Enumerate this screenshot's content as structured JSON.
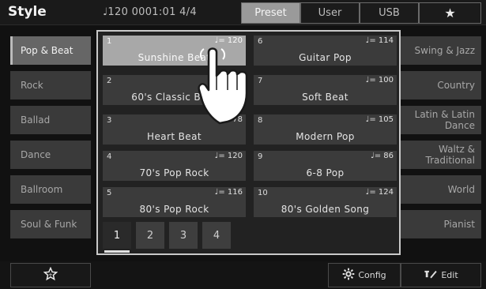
{
  "header": {
    "title": "Style",
    "tempo_readout": "♩120  0001:01  4/4",
    "tabs": [
      "Preset",
      "User",
      "USB",
      "★"
    ]
  },
  "left_categories": [
    "Pop & Beat",
    "Rock",
    "Ballad",
    "Dance",
    "Ballroom",
    "Soul & Funk"
  ],
  "right_categories": [
    "Swing & Jazz",
    "Country",
    "Latin & Latin\nDance",
    "Waltz &\nTraditional",
    "World",
    "Pianist"
  ],
  "styles": [
    {
      "num": "1",
      "tempo": "♩= 120",
      "name": "Sunshine Beat"
    },
    {
      "num": "2",
      "tempo": "♩= 1",
      "name": "60's Classic Beat"
    },
    {
      "num": "3",
      "tempo": "♩= 78",
      "name": "Heart Beat"
    },
    {
      "num": "4",
      "tempo": "♩= 120",
      "name": "70's Pop Rock"
    },
    {
      "num": "5",
      "tempo": "♩= 116",
      "name": "80's Pop Rock"
    },
    {
      "num": "6",
      "tempo": "♩= 114",
      "name": "Guitar Pop"
    },
    {
      "num": "7",
      "tempo": "♩= 100",
      "name": "Soft Beat"
    },
    {
      "num": "8",
      "tempo": "♩= 105",
      "name": "Modern Pop"
    },
    {
      "num": "9",
      "tempo": "♩= 86",
      "name": "6-8 Pop"
    },
    {
      "num": "10",
      "tempo": "♩= 124",
      "name": "80's Golden Song"
    }
  ],
  "pages": [
    "1",
    "2",
    "3",
    "4"
  ],
  "footer": {
    "favorite_icon": "star-outline-icon",
    "config_label": "Config",
    "edit_label": "Edit"
  }
}
